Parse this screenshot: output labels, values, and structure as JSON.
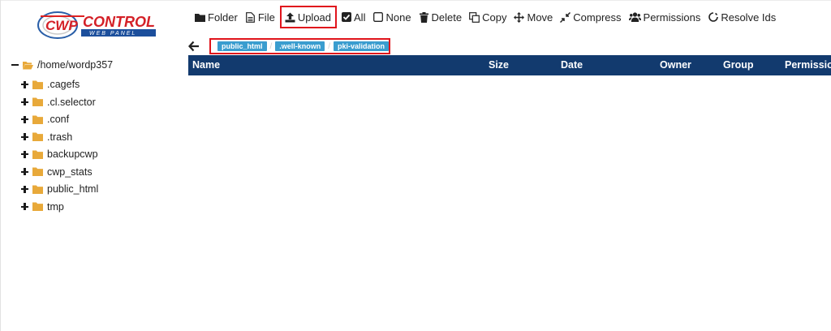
{
  "logo": {
    "text_main": "CWP",
    "text_control": "CONTROL",
    "text_sub": "WEB PANEL"
  },
  "toolbar": {
    "folder": "Folder",
    "file": "File",
    "upload": "Upload",
    "all": "All",
    "none": "None",
    "delete": "Delete",
    "copy": "Copy",
    "move": "Move",
    "compress": "Compress",
    "permissions": "Permissions",
    "resolve_ids": "Resolve Ids"
  },
  "breadcrumb": {
    "items": [
      "public_html",
      ".well-known",
      "pki-validation"
    ],
    "separator": "/"
  },
  "table": {
    "columns": [
      "Name",
      "Size",
      "Date",
      "Owner",
      "Group",
      "Permission"
    ]
  },
  "tree": {
    "root": "/home/wordp357",
    "items": [
      ".cagefs",
      ".cl.selector",
      ".conf",
      ".trash",
      "backupcwp",
      "cwp_stats",
      "public_html",
      "tmp"
    ]
  },
  "colors": {
    "header_bg": "#123a6e",
    "crumb_bg": "#3a9dcf",
    "highlight": "#e0141c",
    "folder": "#e8a93a"
  }
}
